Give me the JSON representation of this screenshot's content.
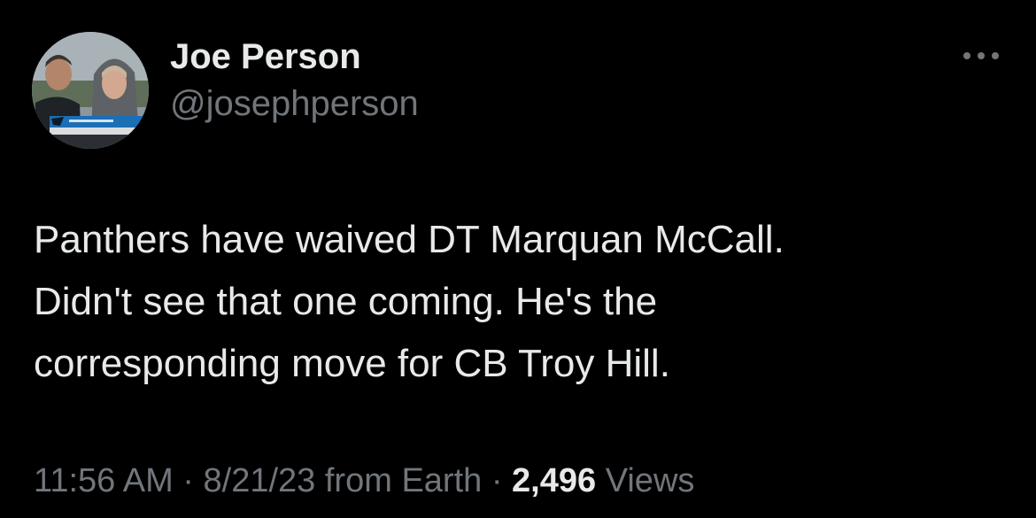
{
  "tweet": {
    "author": {
      "display_name": "Joe Person",
      "handle": "@josephperson"
    },
    "text": "Panthers have waived DT Marquan McCall.\nDidn't see that one coming. He's the\ncorresponding move for CB Troy Hill.",
    "meta": {
      "time": "11:56 AM",
      "separator": "·",
      "date": "8/21/23",
      "source_prefix": "from",
      "source": "Earth",
      "views_count": "2,496",
      "views_label": "Views"
    },
    "more_icon": "more-horizontal-icon",
    "colors": {
      "background": "#000000",
      "primary_text": "#e7e9ea",
      "secondary_text": "#71767b"
    }
  }
}
